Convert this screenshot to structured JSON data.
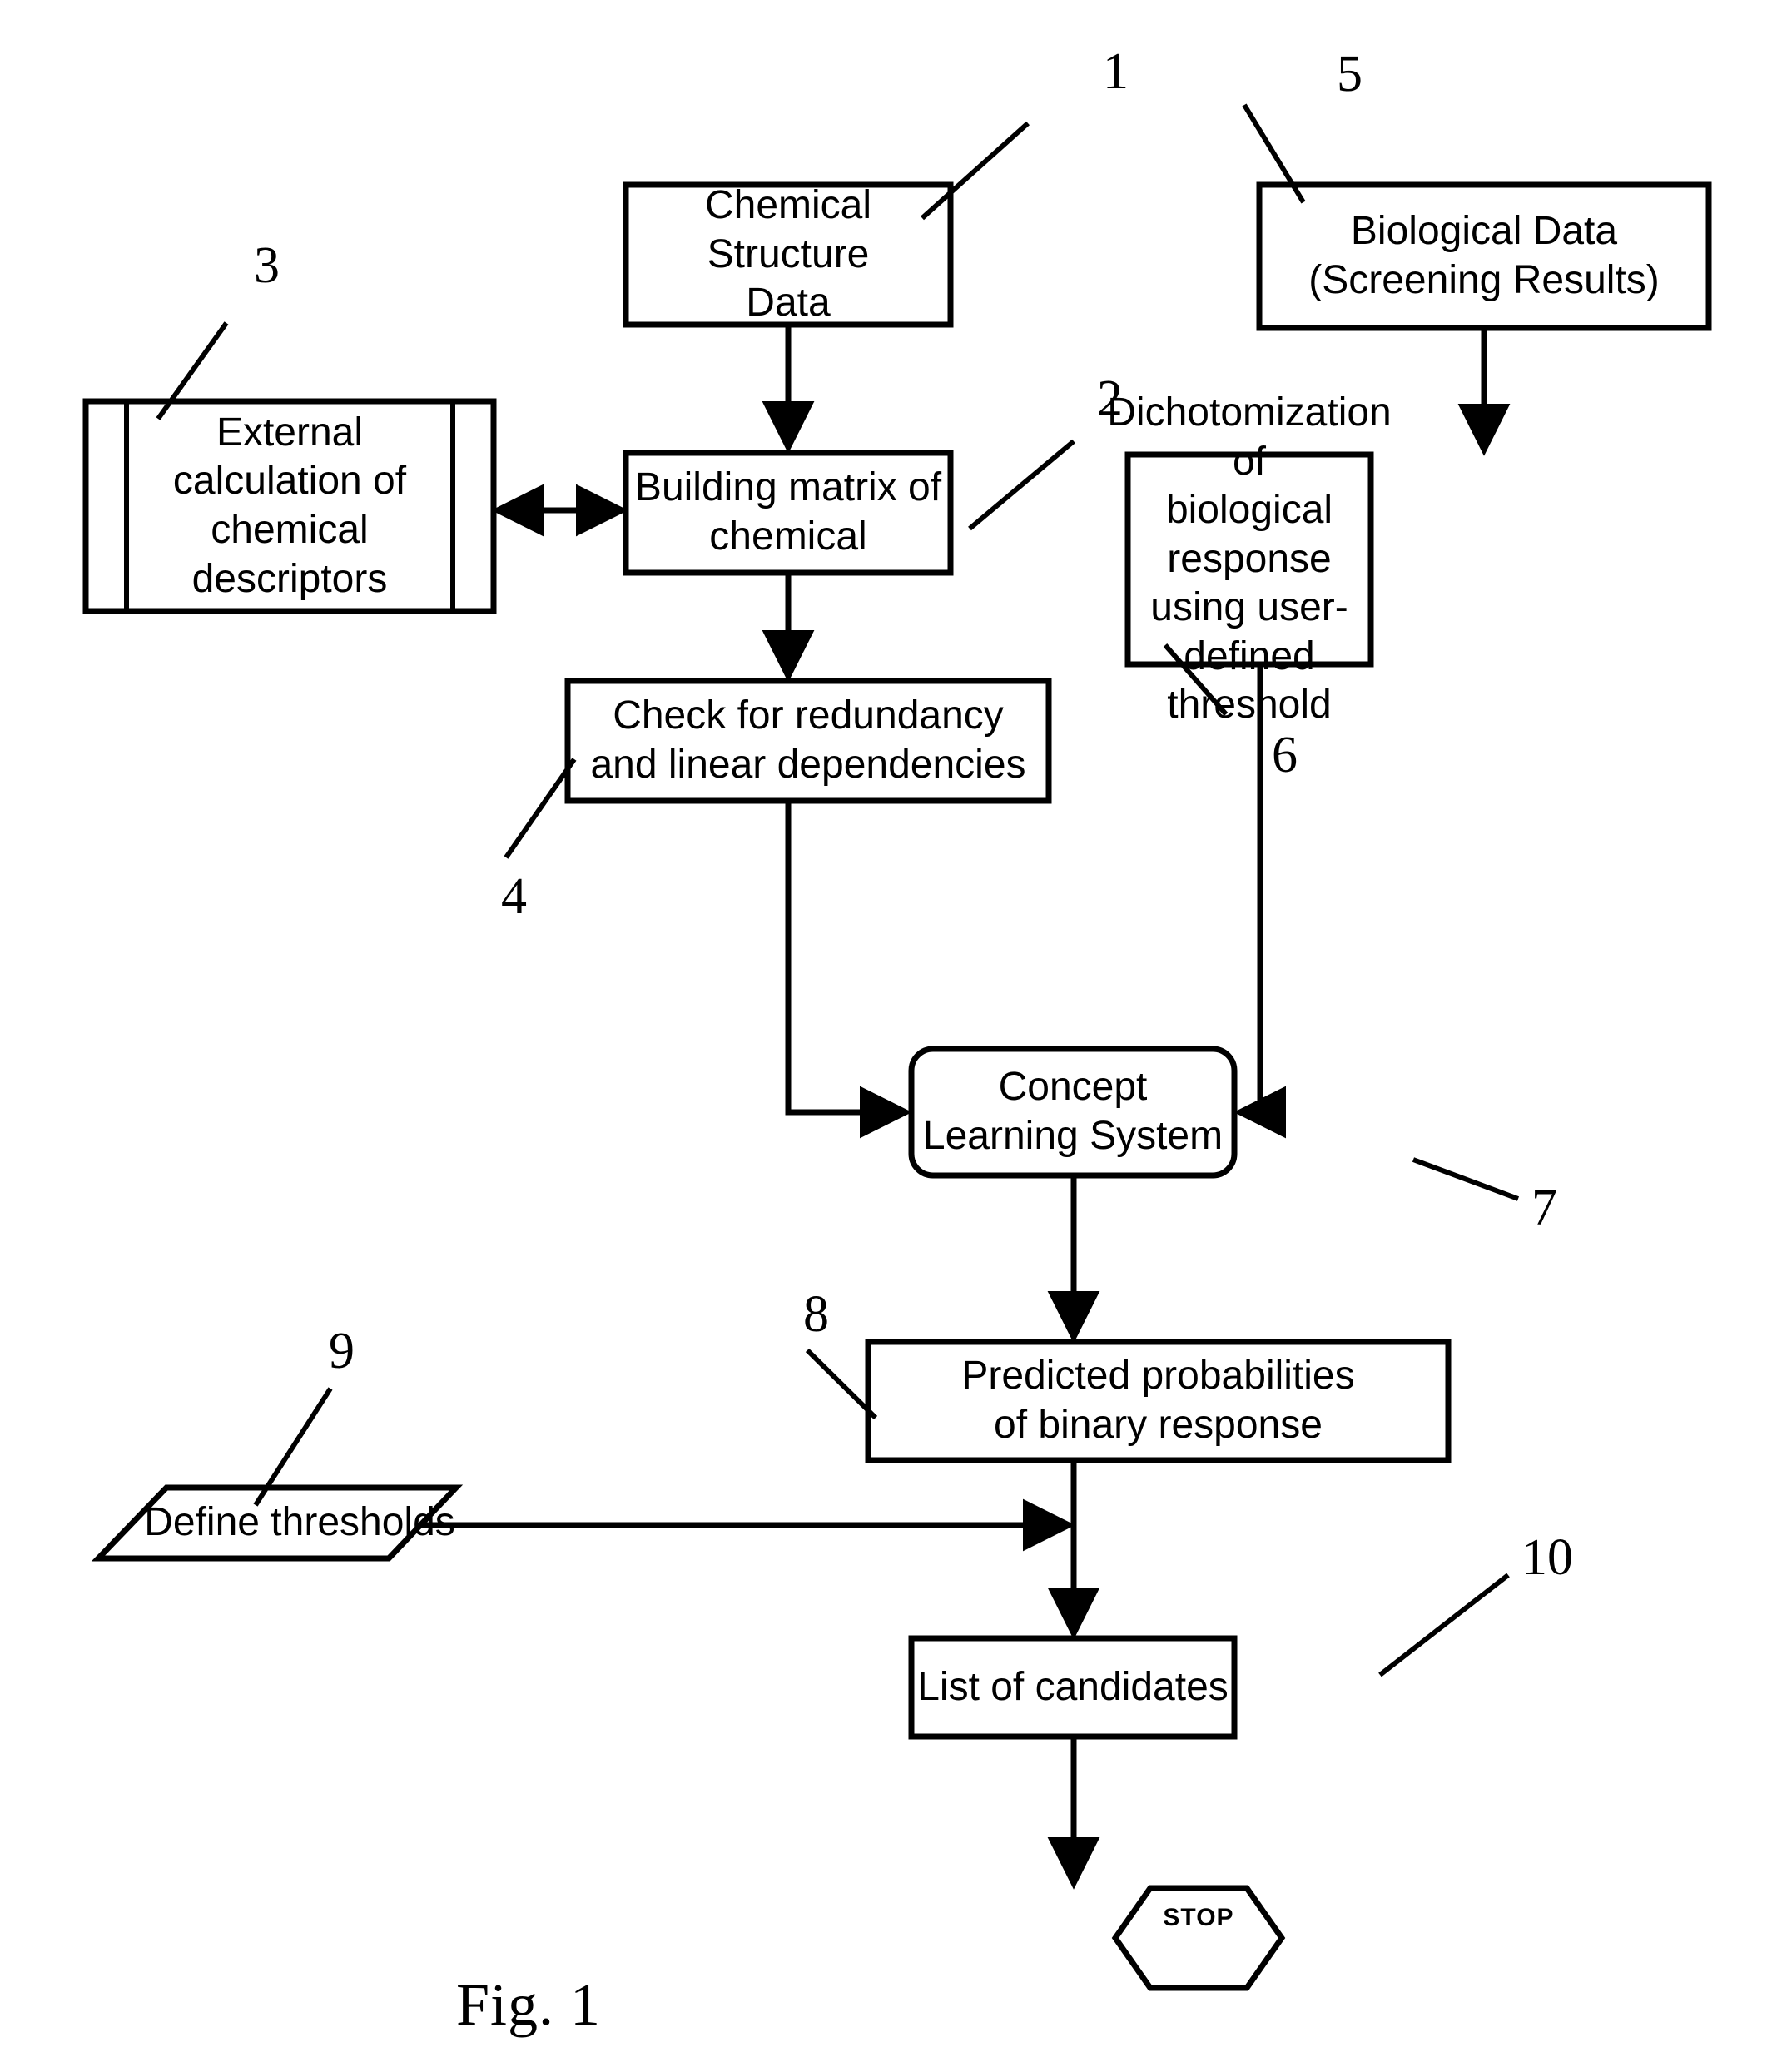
{
  "figure": {
    "caption": "Fig. 1",
    "line_color": "#000000",
    "background_color": "#ffffff"
  },
  "nodes": {
    "chemical_structure_data": {
      "label": "Chemical Structure\nData",
      "ref": "1",
      "shape": "process-rectangle",
      "font_size": 48
    },
    "building_matrix": {
      "label": "Building matrix of\nchemical",
      "ref": "2",
      "shape": "process-rectangle",
      "font_size": 48
    },
    "external_calculation": {
      "label": "External\ncalculation of\nchemical\ndescriptors",
      "ref": "3",
      "shape": "predefined-process",
      "font_size": 48
    },
    "check_redundancy": {
      "label": "Check for redundancy\nand linear dependencies",
      "ref": "4",
      "shape": "process-rectangle",
      "font_size": 48
    },
    "biological_data": {
      "label": "Biological Data\n(Screening Results)",
      "ref": "5",
      "shape": "process-rectangle",
      "font_size": 48
    },
    "dichotomization": {
      "label": "Dichotomization of\nbiological response\nusing user-defined\nthreshold",
      "ref": "6",
      "shape": "process-rectangle",
      "font_size": 48
    },
    "concept_learning_system": {
      "label": "Concept\nLearning System",
      "ref": "7",
      "shape": "rounded-rectangle",
      "font_size": 48
    },
    "predicted_probabilities": {
      "label": "Predicted probabilities\nof binary response",
      "ref": "8",
      "shape": "process-rectangle",
      "font_size": 48
    },
    "define_thresholds": {
      "label": "Define thresholds",
      "ref": "9",
      "shape": "parallelogram-input",
      "font_size": 48
    },
    "list_of_candidates": {
      "label": "List of candidates",
      "ref": "10",
      "shape": "process-rectangle",
      "font_size": 48
    },
    "stop_terminator": {
      "label": "STOP",
      "shape": "hexagon",
      "font_size": 30
    }
  },
  "connectors": [
    {
      "name": "chemical-structure-to-building-matrix",
      "kind": "arrow-down"
    },
    {
      "name": "external-calculation-to-building-matrix",
      "kind": "double-headed-arrow-horizontal"
    },
    {
      "name": "building-matrix-to-check-redundancy",
      "kind": "arrow-down"
    },
    {
      "name": "check-redundancy-to-concept-learning",
      "kind": "elbow-arrow-right"
    },
    {
      "name": "biological-data-to-dichotomization",
      "kind": "arrow-down"
    },
    {
      "name": "dichotomization-to-concept-learning",
      "kind": "elbow-arrow-left"
    },
    {
      "name": "concept-learning-to-predicted-probabilities",
      "kind": "arrow-down"
    },
    {
      "name": "define-thresholds-to-main-flow",
      "kind": "arrow-right"
    },
    {
      "name": "predicted-probabilities-to-list-of-candidates",
      "kind": "arrow-down"
    },
    {
      "name": "list-of-candidates-to-stop",
      "kind": "arrow-down"
    }
  ]
}
